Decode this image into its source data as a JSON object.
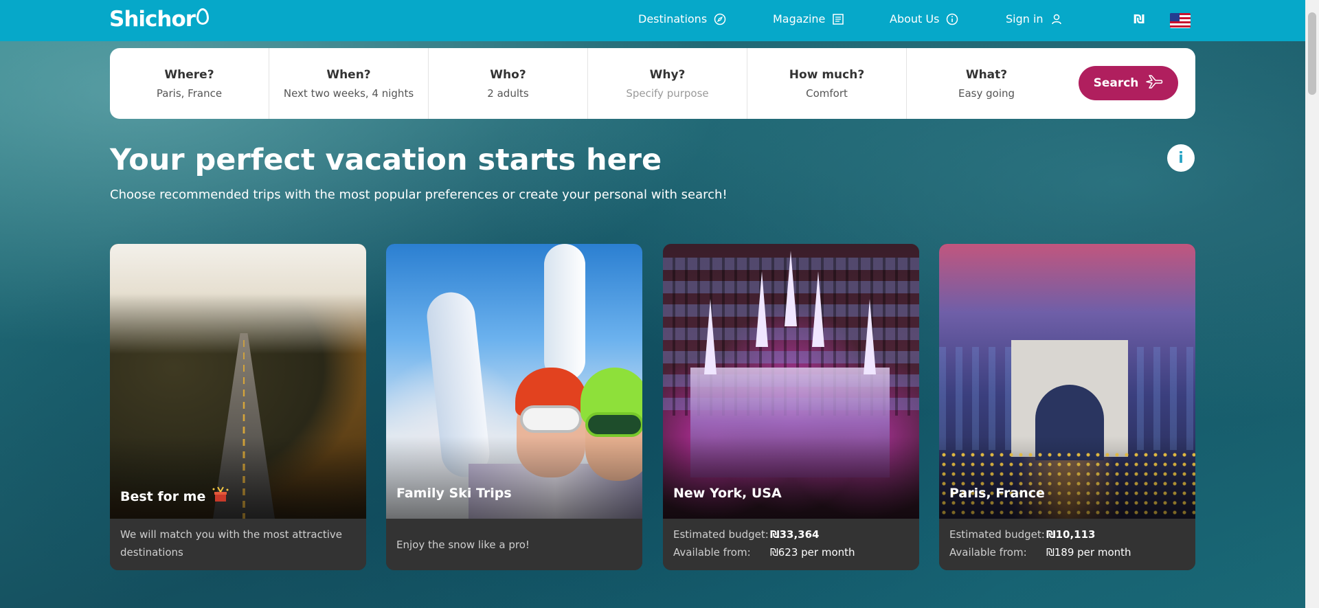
{
  "header": {
    "logo": "Shichor",
    "nav": [
      {
        "label": "Destinations",
        "icon": "compass-icon"
      },
      {
        "label": "Magazine",
        "icon": "document-icon"
      },
      {
        "label": "About Us",
        "icon": "info-icon"
      },
      {
        "label": "Sign in",
        "icon": "user-icon"
      }
    ],
    "currency": "₪",
    "language_flag": "us-flag"
  },
  "search": {
    "fields": [
      {
        "label": "Where?",
        "value": "Paris, France"
      },
      {
        "label": "When?",
        "value": "Next two weeks, 4 nights"
      },
      {
        "label": "Who?",
        "value": "2 adults"
      },
      {
        "label": "Why?",
        "value": "Specify purpose"
      },
      {
        "label": "How much?",
        "value": "Comfort"
      },
      {
        "label": "What?",
        "value": "Easy going"
      }
    ],
    "button_label": "Search"
  },
  "hero": {
    "title": "Your perfect vacation starts here",
    "subtitle": "Choose recommended trips with the most popular preferences or create your personal with search!",
    "info_symbol": "i"
  },
  "cards": [
    {
      "title": "Best for me",
      "description": "We will match you with the most attractive destinations"
    },
    {
      "title": "Family Ski Trips",
      "description": "Enjoy the snow like a pro!"
    },
    {
      "title": "New York, USA",
      "budget_label": "Estimated budget:",
      "budget_value": "₪33,364",
      "available_label": "Available from:",
      "available_value": "₪623 per month"
    },
    {
      "title": "Paris, France",
      "budget_label": "Estimated budget:",
      "budget_value": "₪10,113",
      "available_label": "Available from:",
      "available_value": "₪189 per month"
    }
  ],
  "colors": {
    "header_bg": "#06a8c9",
    "search_button": "#b01f5e"
  }
}
